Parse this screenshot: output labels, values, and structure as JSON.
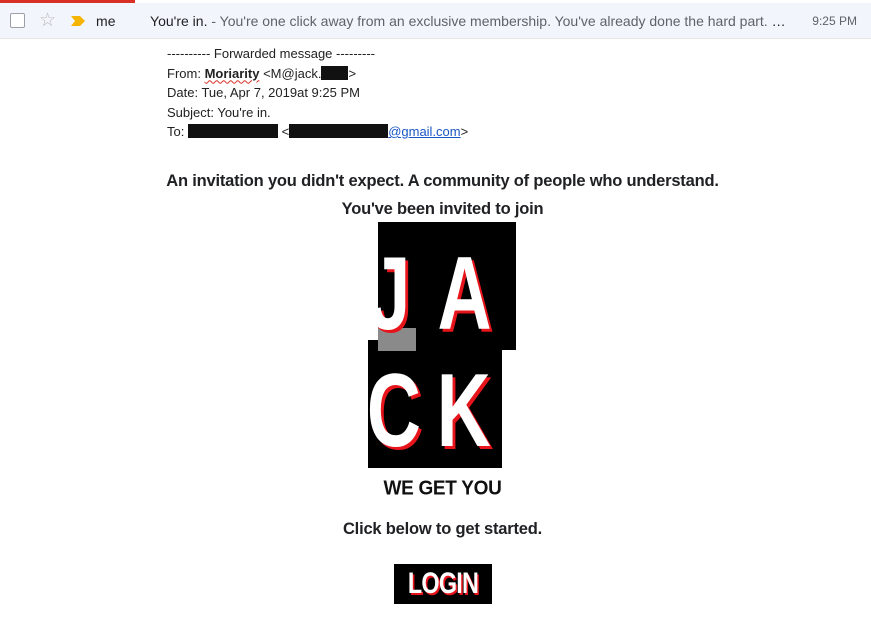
{
  "topbar": {
    "sender": "me",
    "subject": "You're in.",
    "snippet": " - You're one click away from an exclusive membership. You've already done the hard part. Who you are. What you want. Now it's time to let us help.",
    "time": "9:25 PM",
    "icons": [
      "checkbox-icon",
      "star-icon",
      "important-marker-icon"
    ]
  },
  "forward": {
    "header": "---------- Forwarded message ---------",
    "from_label": "From: ",
    "from_name": "Moriarity",
    "from_email": " <M@jack.",
    "from_close": ">",
    "date": "Date: Tue, Apr 7, 2019at 9:25 PM",
    "subject": "Subject: You're in.",
    "to_label": "To: ",
    "to_open": " <",
    "to_domain": "@gmail.com",
    "to_close": ">"
  },
  "content": {
    "tagline": "An invitation you didn't expect. A community of people who understand.",
    "invited": "You've been invited to join",
    "logo_letters": [
      "J",
      "A",
      "C",
      "K"
    ],
    "slogan": "WE GET YOU",
    "cta_text": "Click below to get started.",
    "login_label": "LOGIN"
  },
  "colors": {
    "accent_red": "#e8141b",
    "black": "#000000",
    "link": "#1a56c4",
    "topbar_bg": "#f2f6fc"
  }
}
